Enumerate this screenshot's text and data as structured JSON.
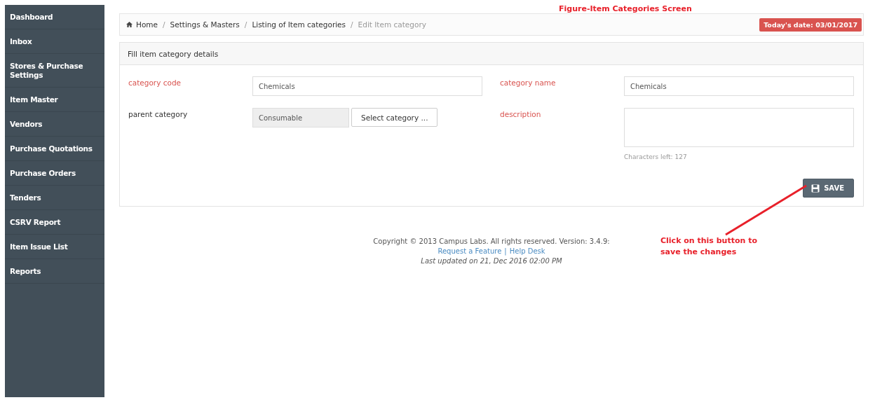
{
  "sidebar": {
    "items": [
      {
        "label": "Dashboard"
      },
      {
        "label": "Inbox"
      },
      {
        "label": "Stores & Purchase Settings"
      },
      {
        "label": "Item Master"
      },
      {
        "label": "Vendors"
      },
      {
        "label": "Purchase Quotations"
      },
      {
        "label": "Purchase Orders"
      },
      {
        "label": "Tenders"
      },
      {
        "label": "CSRV Report"
      },
      {
        "label": "Item Issue List"
      },
      {
        "label": "Reports"
      }
    ]
  },
  "breadcrumb": {
    "items": [
      {
        "label": "Home",
        "current": false
      },
      {
        "label": "Settings & Masters",
        "current": false
      },
      {
        "label": "Listing of Item categories",
        "current": false
      },
      {
        "label": "Edit Item category",
        "current": true
      }
    ],
    "separator": "/",
    "date_badge": "Today's date: 03/01/2017"
  },
  "panel": {
    "title": "Fill item category details",
    "fields": [
      {
        "kind": "text",
        "label": "category code",
        "required": true,
        "value": "Chemicals"
      },
      {
        "kind": "text",
        "label": "category name",
        "required": true,
        "value": "Chemicals"
      },
      {
        "kind": "picker",
        "label": "parent category",
        "required": false,
        "value": "Consumable",
        "disabled": true,
        "button": "Select category ..."
      },
      {
        "kind": "textarea",
        "label": "description",
        "required": true,
        "hint": "Characters left: 127"
      }
    ],
    "save_button": "SAVE"
  },
  "footer": {
    "copyright": "Copyright © 2013 Campus Labs. All rights reserved. Version: 3.4.9:",
    "links": [
      "Request a Feature",
      "Help Desk"
    ],
    "link_separator": "|",
    "updated": "Last updated on 21, Dec 2016 02:00 PM"
  },
  "annotations": {
    "title": "Figure-Item Categories Screen",
    "callout": "Click on this button to save the changes"
  }
}
